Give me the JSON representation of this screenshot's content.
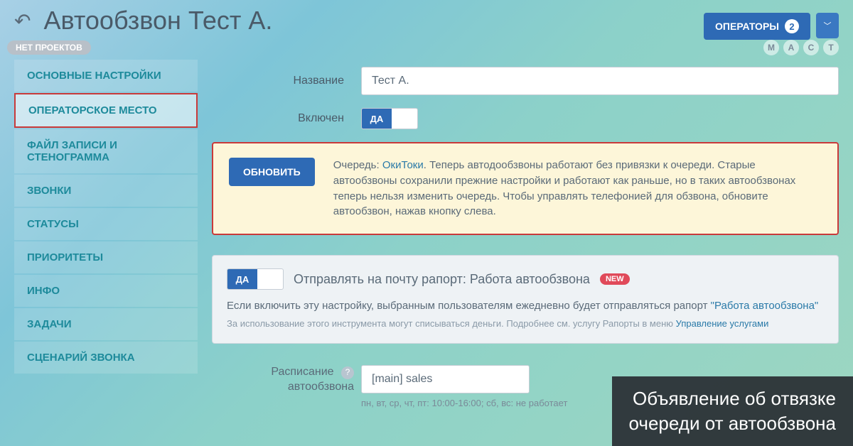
{
  "header": {
    "title": "Автообзвон Тест А.",
    "operators_label": "ОПЕРАТОРЫ",
    "operators_count": "2",
    "no_projects": "НЕТ ПРОЕКТОВ",
    "circles": [
      "М",
      "А",
      "С",
      "Т"
    ]
  },
  "sidebar": {
    "items": [
      "ОСНОВНЫЕ НАСТРОЙКИ",
      "ОПЕРАТОРСКОЕ МЕСТО",
      "ФАЙЛ ЗАПИСИ И СТЕНОГРАММА",
      "ЗВОНКИ",
      "СТАТУСЫ",
      "ПРИОРИТЕТЫ",
      "ИНФО",
      "ЗАДАЧИ",
      "СЦЕНАРИЙ ЗВОНКА"
    ]
  },
  "form": {
    "name_label": "Название",
    "name_value": "Тест А.",
    "enabled_label": "Включен",
    "toggle_on": "ДА"
  },
  "infobox": {
    "update_btn": "ОБНОВИТЬ",
    "prefix": "Очередь: ",
    "link": "ОкиТоки",
    "text": ". Теперь автодообзвоны работают без привязки к очереди. Старые автообзвоны сохранили прежние настройки и работают как раньше, но в таких автообзвонах теперь нельзя изменить очередь. Чтобы управлять телефонией для обзвона, обновите автообзвон, нажав кнопку слева."
  },
  "report": {
    "toggle_on": "ДА",
    "title": "Отправлять на почту рапорт: Работа автообзвона",
    "new": "NEW",
    "desc_pre": "Если включить эту настройку, выбранным пользователям ежедневно будет отправляться рапорт ",
    "desc_link": "\"Работа автообзвона\"",
    "sub_pre": "За использование этого инструмента могут списываться деньги. Подробнее см. услугу Рапорты в меню ",
    "sub_link": "Управление услугами"
  },
  "schedule": {
    "label1": "Расписание",
    "label2": "автообзвона",
    "value": "[main] sales",
    "sub": "пн, вт, ср, чт, пт: 10:00-16:00; сб, вс: не работает"
  },
  "overlay": {
    "line1": "Объявление об отвязке",
    "line2": "очереди от автообзвона"
  }
}
